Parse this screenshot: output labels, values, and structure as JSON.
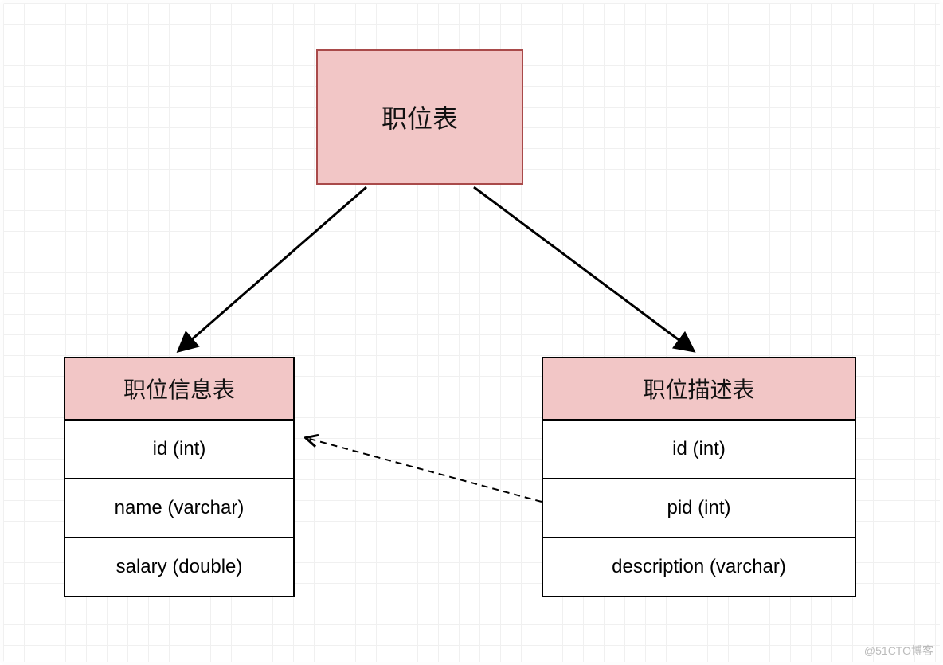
{
  "topBox": {
    "title": "职位表"
  },
  "leftTable": {
    "header": "职位信息表",
    "rows": [
      "id (int)",
      "name (varchar)",
      "salary (double)"
    ]
  },
  "rightTable": {
    "header": "职位描述表",
    "rows": [
      "id (int)",
      "pid (int)",
      "description (varchar)"
    ]
  },
  "watermark": "@51CTO博客"
}
